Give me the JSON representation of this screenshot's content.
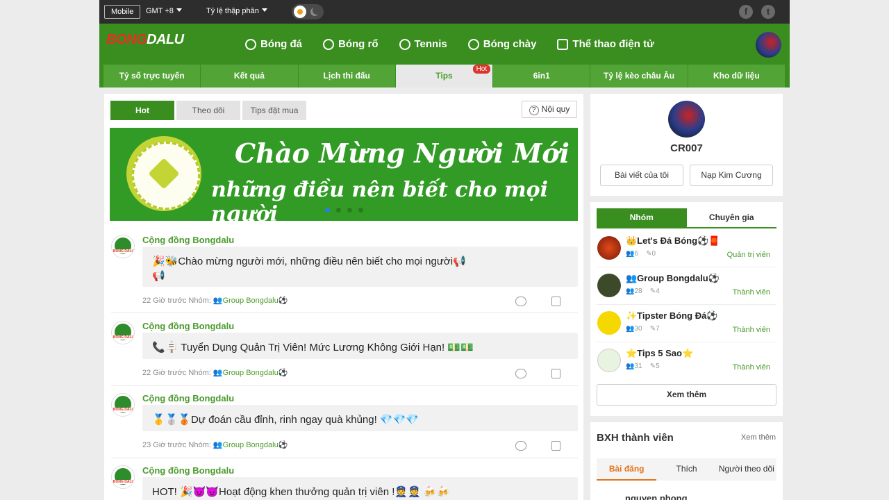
{
  "topbar": {
    "mobile_label": "Mobile",
    "timezone": "GMT +8",
    "odds_format": "Tỷ lệ thập phân"
  },
  "header": {
    "logo_part1": "BONG",
    "logo_part2": "DALU",
    "sports": [
      {
        "label": "Bóng đá",
        "icon": "soccer-ball-icon"
      },
      {
        "label": "Bóng rổ",
        "icon": "basketball-icon"
      },
      {
        "label": "Tennis",
        "icon": "tennis-icon"
      },
      {
        "label": "Bóng chày",
        "icon": "baseball-icon"
      },
      {
        "label": "Thể thao điện tử",
        "icon": "gamepad-icon"
      }
    ]
  },
  "subnav": {
    "tabs": [
      "Tỷ số trực tuyến",
      "Kết quả",
      "Lịch thi đấu",
      "Tips",
      "6in1",
      "Tỷ lệ kèo châu Âu",
      "Kho dữ liệu"
    ],
    "hot_badge": "Hot"
  },
  "feed": {
    "tabs": [
      "Hot",
      "Theo dõi",
      "Tips đặt mua"
    ],
    "rules_label": "Nội quy",
    "banner_line1": "Chào Mừng Người Mới",
    "banner_line2": "những điều nên biết cho mọi người",
    "posts": [
      {
        "author": "Cộng đồng Bongdalu",
        "content": "🎉🐝Chào mừng người mới, những điều nên biết cho mọi người📢",
        "content2": "📢",
        "time": "22 Giờ trước Nhóm:",
        "group": "👥Group Bongdalu⚽"
      },
      {
        "author": "Cộng đồng Bongdalu",
        "content": "📞🪧 Tuyển Dụng Quản Trị Viên! Mức Lương Không Giới Hạn! 💵💵",
        "time": "22 Giờ trước Nhóm:",
        "group": "👥Group Bongdalu⚽"
      },
      {
        "author": "Cộng đồng Bongdalu",
        "content": "🥇🥈🥉Dự đoán cầu đỉnh, rinh ngay quà khủng! 💎💎💎",
        "time": "23 Giờ trước Nhóm:",
        "group": "👥Group Bongdalu⚽"
      },
      {
        "author": "Cộng đồng Bongdalu",
        "content": "HOT! 🎉😈😈Hoạt động khen thưởng quản trị viên !👮👮 🍻🍻"
      }
    ]
  },
  "profile": {
    "name": "CR007",
    "btn_posts": "Bài viết của tôi",
    "btn_diamond": "Nạp Kim Cương"
  },
  "groups": {
    "tabs": [
      "Nhóm",
      "Chuyên gia"
    ],
    "items": [
      {
        "name": "👑Let's Đá Bóng⚽🧧",
        "members": "6",
        "posts": "0",
        "role": "Quản trị viên"
      },
      {
        "name": "👥Group Bongdalu⚽",
        "members": "28",
        "posts": "4",
        "role": "Thành viên"
      },
      {
        "name": "✨Tipster Bóng Đá⚽",
        "members": "30",
        "posts": "7",
        "role": "Thành viên"
      },
      {
        "name": "⭐Tips 5 Sao⭐",
        "members": "31",
        "posts": "5",
        "role": "Thành viên"
      }
    ],
    "more_label": "Xem thêm"
  },
  "ranking": {
    "title": "BXH thành viên",
    "more_label": "Xem thêm",
    "tabs": [
      "Bài đăng",
      "Thích",
      "Người theo dõi"
    ],
    "first_user": "nguyen phong"
  }
}
